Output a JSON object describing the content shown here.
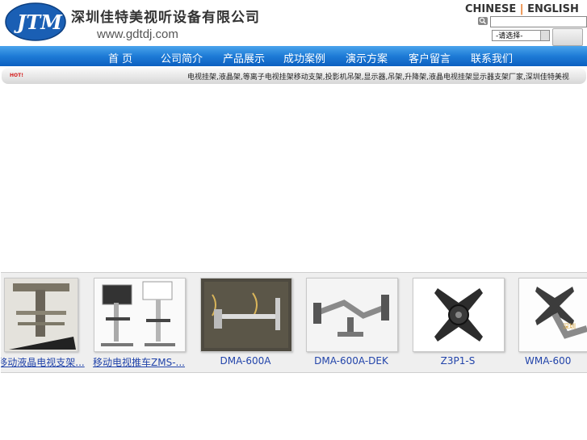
{
  "brand": {
    "logo_text": "JTM",
    "company_name": "深圳佳特美视听设备有限公司",
    "url": "www.gdtdj.com"
  },
  "lang_switch": {
    "chinese": "CHINESE",
    "separator": "|",
    "english": "ENGLISH"
  },
  "search": {
    "input_value": "",
    "select_value": "-请选择-"
  },
  "nav": {
    "items": [
      {
        "label": "首 页"
      },
      {
        "label": "公司简介"
      },
      {
        "label": "产品展示"
      },
      {
        "label": "成功案例"
      },
      {
        "label": "演示方案"
      },
      {
        "label": "客户留言"
      },
      {
        "label": "联系我们"
      }
    ]
  },
  "notice": {
    "badge": "HOT!",
    "text": "电视挂架,液晶架,等离子电视挂架移动支架,投影机吊架,显示器,吊架,升降架,液晶电视挂架显示器支架厂家,深圳佳特美视"
  },
  "products": [
    {
      "name": "移动液晶电视支架..."
    },
    {
      "name": "移动电视推车ZMS-..."
    },
    {
      "name": "DMA-600A"
    },
    {
      "name": "DMA-600A-DEK"
    },
    {
      "name": "Z3P1-S"
    },
    {
      "name": "WMA-600"
    }
  ],
  "colors": {
    "nav_top": "#4aa4ec",
    "nav_bottom": "#0b5fc0",
    "brand_blue": "#1a5fb4",
    "lang_separator": "#e87722",
    "product_link": "#2244aa"
  }
}
